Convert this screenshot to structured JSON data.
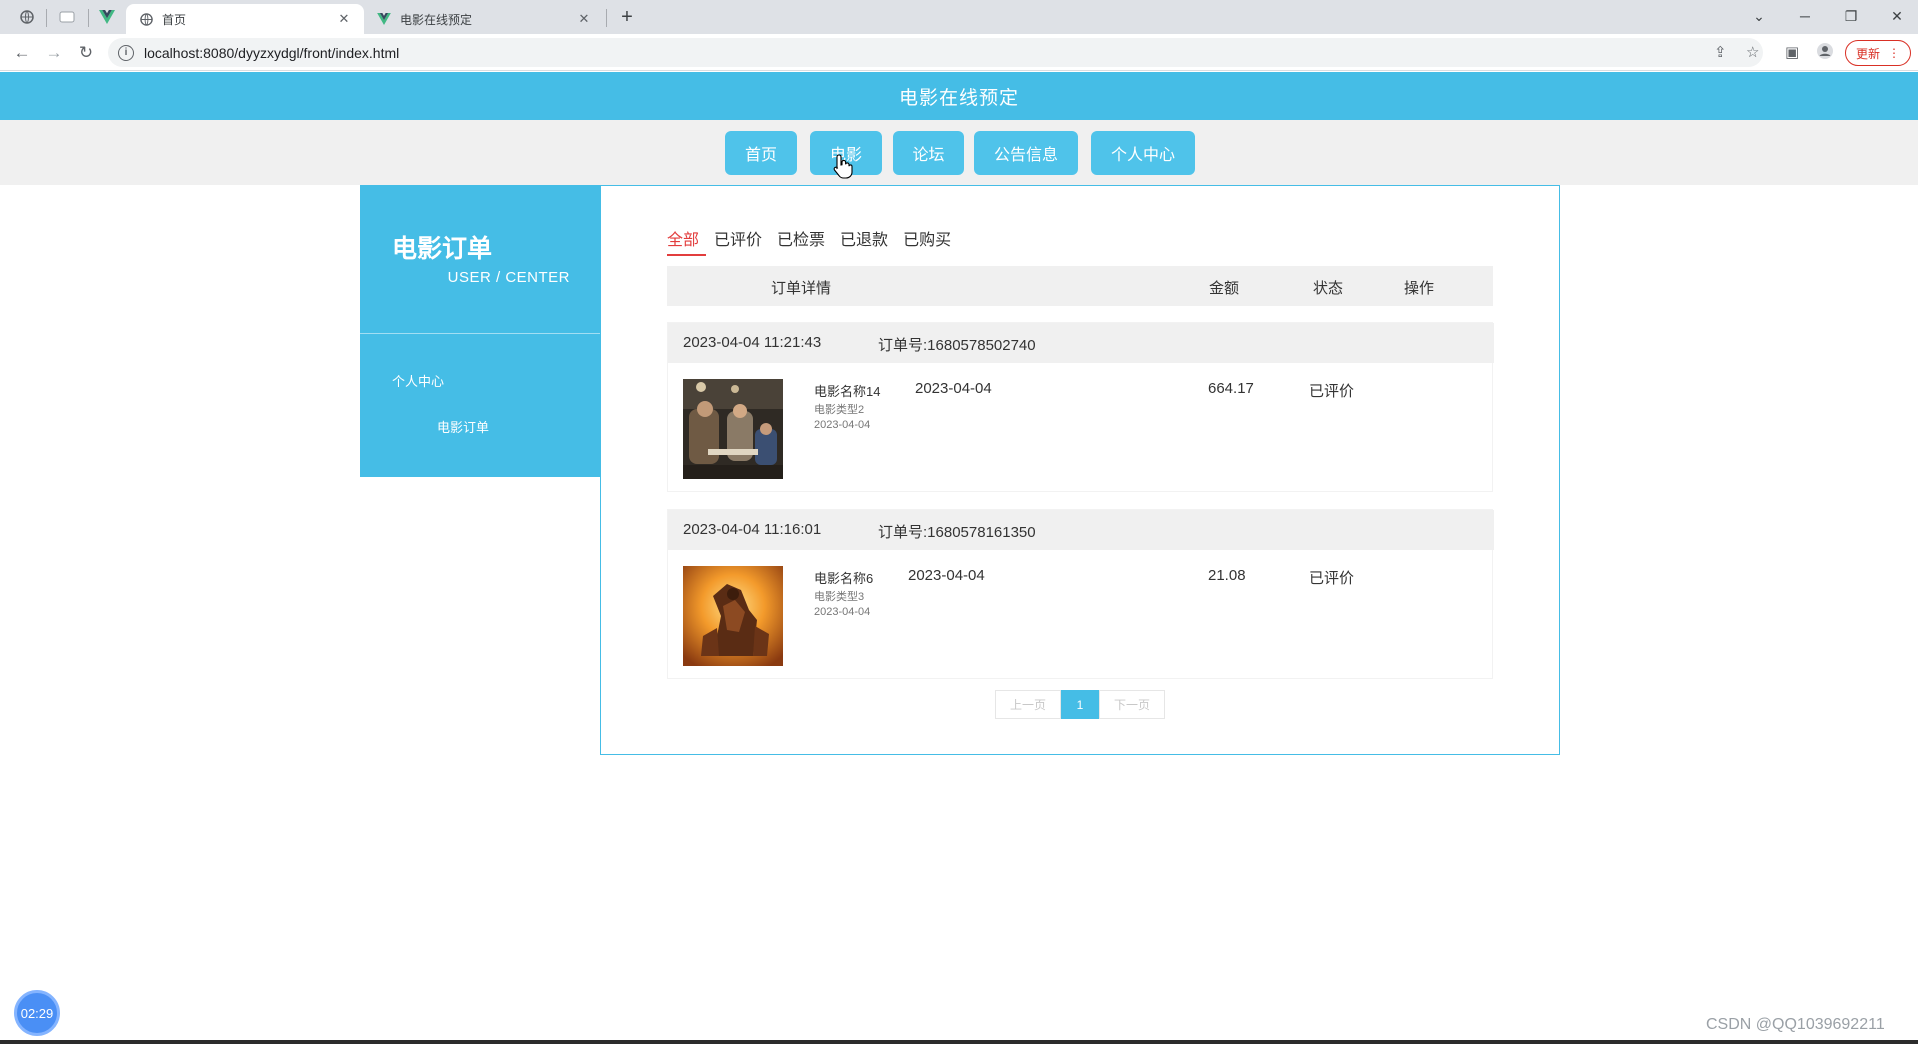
{
  "browser": {
    "tabs": [
      {
        "title": "首页",
        "favicon": "globe-icon"
      },
      {
        "title": "电影在线预定",
        "favicon": "vue-logo-icon"
      }
    ],
    "url": "localhost:8080/dyyzxydgl/front/index.html",
    "update_label": "更新"
  },
  "site": {
    "title": "电影在线预定",
    "nav": [
      "首页",
      "电影",
      "论坛",
      "公告信息",
      "个人中心"
    ]
  },
  "sidebar": {
    "title": "电影订单",
    "subtitle": "USER / CENTER",
    "items": [
      "个人中心",
      "电影订单"
    ]
  },
  "filters": {
    "tabs": [
      "全部",
      "已评价",
      "已检票",
      "已退款",
      "已购买"
    ],
    "active": "全部"
  },
  "table": {
    "headers": [
      "订单详情",
      "金额",
      "状态",
      "操作"
    ]
  },
  "orders": [
    {
      "time": "2023-04-04 11:21:43",
      "order_no": "订单号:1680578502740",
      "movie_name": "电影名称14",
      "movie_type": "电影类型2",
      "movie_date": "2023-04-04",
      "date": "2023-04-04",
      "amount": "664.17",
      "status": "已评价"
    },
    {
      "time": "2023-04-04 11:16:01",
      "order_no": "订单号:1680578161350",
      "movie_name": "电影名称6",
      "movie_type": "电影类型3",
      "movie_date": "2023-04-04",
      "date": "2023-04-04",
      "amount": "21.08",
      "status": "已评价"
    }
  ],
  "pagination": {
    "prev": "上一页",
    "current": "1",
    "next": "下一页"
  },
  "overlay": {
    "timer": "02:29",
    "watermark": "CSDN @QQ1039692211"
  },
  "colors": {
    "primary": "#45bde6",
    "active_filter": "#e23d3d",
    "nav_bg": "#f0f0f0"
  }
}
